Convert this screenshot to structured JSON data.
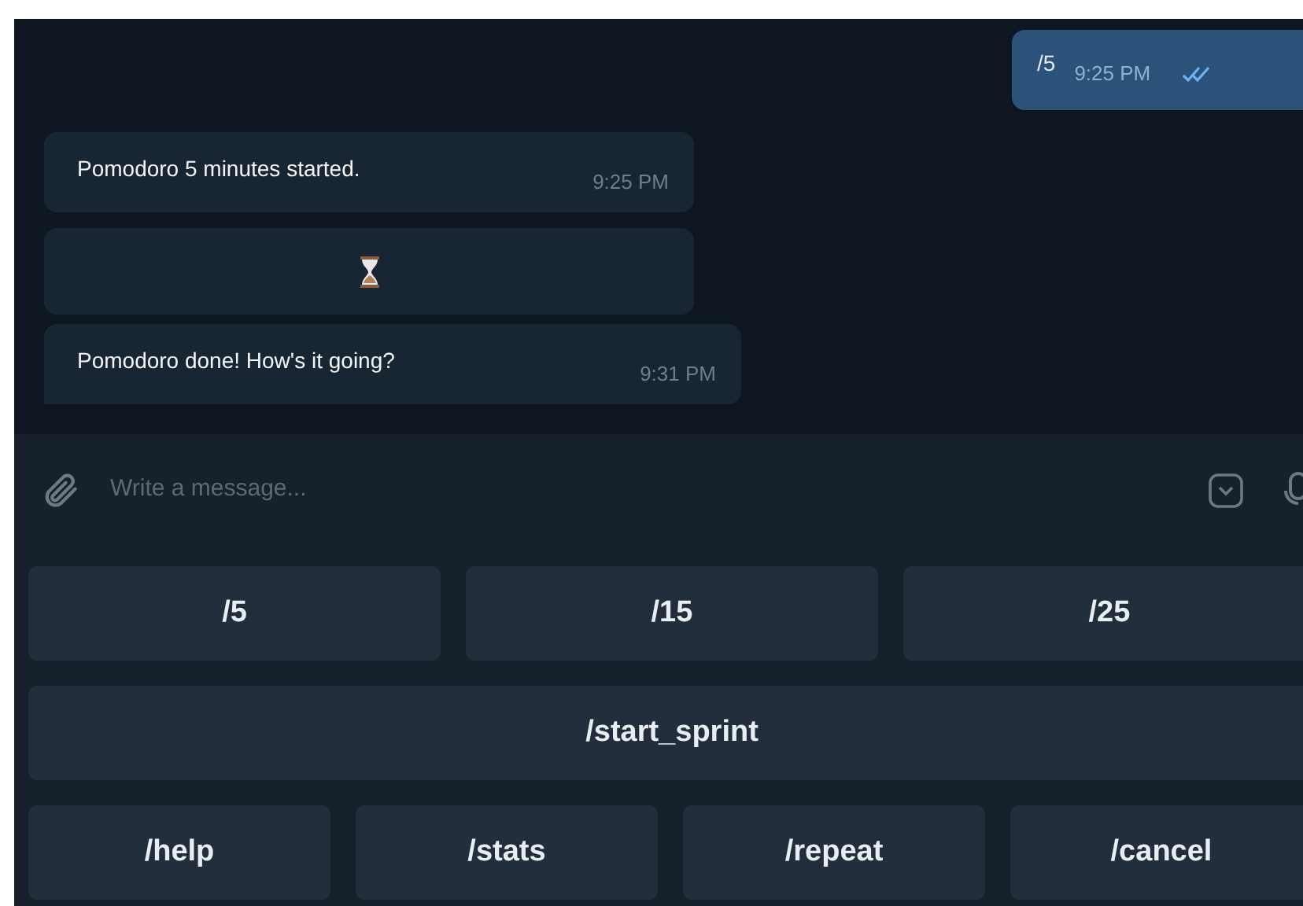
{
  "messages": [
    {
      "kind": "outgoing",
      "text": "/5",
      "time": "9:25 PM",
      "read": true
    },
    {
      "kind": "incoming",
      "text": "Pomodoro 5 minutes started.",
      "time": "9:25 PM",
      "tail": false
    },
    {
      "kind": "sticker"
    },
    {
      "kind": "incoming",
      "text": "Pomodoro done! How's it going?",
      "time": "9:31 PM",
      "tail": true
    }
  ],
  "composer": {
    "placeholder": "Write a message..."
  },
  "keyboard": [
    [
      "/5",
      "/15",
      "/25"
    ],
    [
      "/start_sprint"
    ],
    [
      "/help",
      "/stats",
      "/repeat",
      "/cancel"
    ]
  ]
}
